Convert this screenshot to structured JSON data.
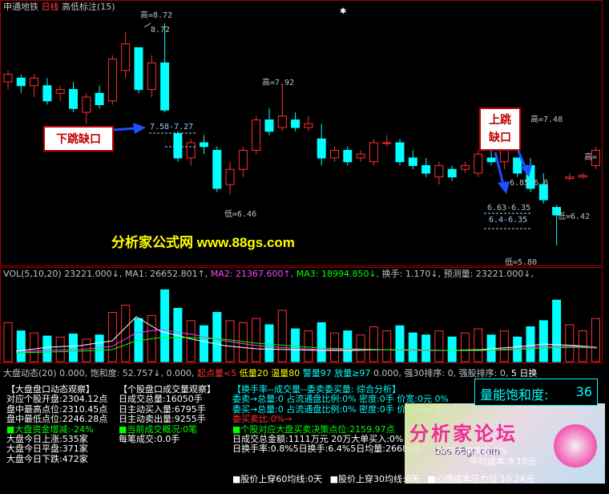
{
  "header": {
    "stock": "申通地铁",
    "period": "日线",
    "indicator": "高低标注(15)"
  },
  "main_chart": {
    "price_labels": {
      "high_1": "高=8.72",
      "high_1_sub": "8.72",
      "high_2": "高=7.92",
      "high_3": "高=7.48",
      "high_4": "高=",
      "low_1": "低=6.46",
      "low_2": "低=5.80",
      "low_3": "低=6.42",
      "gap_1": "7.58-7.27",
      "gap_2": "6.63-6.35",
      "gap_3": "6.4-6.35",
      "gap_4": "6.85-6.8"
    },
    "callout_down": "下跳缺口",
    "callout_up": "上跳\n缺口",
    "watermark": "分析家公式网 www.88gs.com"
  },
  "vol_header": {
    "name": "VOL(5,10,20)",
    "v": "23221.000↓,",
    "ma1": "MA1: 26652.801↑,",
    "ma2": "MA2: 21367.600↑,",
    "ma3": "MA3: 18994.850↓,",
    "turnover": "换手: 1.170↓,",
    "forecast": "预测量: 23221.000↓,"
  },
  "market_header": {
    "name": "大盘动态(20)",
    "v1": "0.000,",
    "saturation": "饱和度: 52.757↓,",
    "v2": "0.000,",
    "surge": "起点量<5",
    "low_vol": "低量20",
    "warm_vol": "温量80",
    "alert_vol": "警量97",
    "big_vol": "放量≥97",
    "v3": "0.000,",
    "strong30": "强30排序: 0,",
    "strong_stock": "强股排序: 0,",
    "day": "5 日换"
  },
  "panel1": {
    "title": "【大盘盘口动态观察】",
    "rows": [
      "对应个股开盘:2304.12点",
      "盘中最高点位:2310.45点",
      "盘中最低点位:2246.28点",
      "■大盘资金增减:-24%",
      "大盘今日上涨:535家",
      "大盘今日平盘:371家",
      "大盘今日下跌:472家"
    ]
  },
  "panel2": {
    "title": "【个股盘口成交量观察】",
    "rows": [
      "日成交总量:16050手",
      "日主动买入量:6795手",
      "日主动卖出量:9255手",
      "■当前成交概况:0笔",
      "每笔成交:0.0手"
    ]
  },
  "panel3": {
    "title": "【换手率--成交量--委卖委买量: 综合分析】",
    "rows": [
      "委卖→总量:0 占流通盘比例:0% 密度:0手 价宽:0元 0%",
      "委买→总量:0 占流通盘比例:0% 密度:0手 价宽:0元 0%",
      "委买卖比:0%→",
      "■个股对应大盘买卖决策点位:2159.97点",
      "日成交总金额:1111万元     20万大单买入:0%",
      "日换手率:0.8%5日换手:6.4%5日均量:26680手",
      "■股价上穿60均线:0天",
      "■股价上穿30均线:0天",
      "■心理成本压力位:10.24元"
    ],
    "row7_right": "20万大单卖出:0%",
    "row7_b": "平均成本:9.10元"
  },
  "sat_box": {
    "label": "量能饱和度:",
    "value": "36"
  },
  "forum_watermark": {
    "title": "分析家论坛",
    "url": "bbs.88gs.com"
  },
  "colors": {
    "up": "#ff3030",
    "down": "#00ffff",
    "text": "#c0c0c0",
    "yellow": "#ffff00",
    "green": "#00ff00"
  },
  "chart_data": {
    "type": "candlestick",
    "title": "申通地铁 日线",
    "candles": [
      {
        "o": 7.95,
        "h": 8.1,
        "l": 7.85,
        "c": 8.05
      },
      {
        "o": 8.0,
        "h": 8.05,
        "l": 7.8,
        "c": 7.9
      },
      {
        "o": 7.9,
        "h": 8.05,
        "l": 7.75,
        "c": 8.0
      },
      {
        "o": 7.9,
        "h": 8.0,
        "l": 7.65,
        "c": 7.7
      },
      {
        "o": 7.8,
        "h": 7.9,
        "l": 7.7,
        "c": 7.85
      },
      {
        "o": 7.85,
        "h": 7.95,
        "l": 7.55,
        "c": 7.6
      },
      {
        "o": 7.55,
        "h": 7.8,
        "l": 7.4,
        "c": 7.75
      },
      {
        "o": 7.8,
        "h": 7.9,
        "l": 7.6,
        "c": 7.65
      },
      {
        "o": 7.7,
        "h": 8.3,
        "l": 7.65,
        "c": 8.25
      },
      {
        "o": 8.1,
        "h": 8.6,
        "l": 8.0,
        "c": 8.45
      },
      {
        "o": 8.4,
        "h": 8.3,
        "l": 7.8,
        "c": 7.85
      },
      {
        "o": 7.85,
        "h": 8.3,
        "l": 7.75,
        "c": 8.2
      },
      {
        "o": 8.2,
        "h": 8.72,
        "l": 7.55,
        "c": 7.58
      },
      {
        "o": 7.27,
        "h": 7.3,
        "l": 6.9,
        "c": 6.95
      },
      {
        "o": 6.95,
        "h": 7.2,
        "l": 6.85,
        "c": 7.15
      },
      {
        "o": 7.15,
        "h": 7.25,
        "l": 7.0,
        "c": 7.1
      },
      {
        "o": 7.05,
        "h": 7.1,
        "l": 6.5,
        "c": 6.55
      },
      {
        "o": 6.6,
        "h": 6.9,
        "l": 6.46,
        "c": 6.8
      },
      {
        "o": 6.8,
        "h": 7.1,
        "l": 6.7,
        "c": 7.05
      },
      {
        "o": 7.05,
        "h": 7.5,
        "l": 7.0,
        "c": 7.45
      },
      {
        "o": 7.45,
        "h": 7.6,
        "l": 7.25,
        "c": 7.3
      },
      {
        "o": 7.35,
        "h": 7.92,
        "l": 7.3,
        "c": 7.5
      },
      {
        "o": 7.45,
        "h": 7.55,
        "l": 7.3,
        "c": 7.35
      },
      {
        "o": 7.35,
        "h": 7.5,
        "l": 7.3,
        "c": 7.4
      },
      {
        "o": 7.2,
        "h": 7.4,
        "l": 6.85,
        "c": 6.95
      },
      {
        "o": 6.95,
        "h": 7.1,
        "l": 6.9,
        "c": 7.05
      },
      {
        "o": 7.05,
        "h": 7.1,
        "l": 6.85,
        "c": 6.9
      },
      {
        "o": 6.95,
        "h": 7.05,
        "l": 6.9,
        "c": 7.0
      },
      {
        "o": 6.9,
        "h": 7.2,
        "l": 6.85,
        "c": 7.15
      },
      {
        "o": 7.15,
        "h": 7.25,
        "l": 7.1,
        "c": 7.15
      },
      {
        "o": 7.15,
        "h": 7.2,
        "l": 6.85,
        "c": 6.9
      },
      {
        "o": 6.95,
        "h": 7.05,
        "l": 6.8,
        "c": 6.85
      },
      {
        "o": 6.85,
        "h": 6.95,
        "l": 6.7,
        "c": 6.75
      },
      {
        "o": 6.7,
        "h": 6.9,
        "l": 6.6,
        "c": 6.85
      },
      {
        "o": 6.8,
        "h": 6.85,
        "l": 6.65,
        "c": 6.7
      },
      {
        "o": 6.8,
        "h": 6.9,
        "l": 6.75,
        "c": 6.85
      },
      {
        "o": 6.75,
        "h": 7.05,
        "l": 6.7,
        "c": 7.0
      },
      {
        "o": 6.95,
        "h": 7.1,
        "l": 6.85,
        "c": 6.9
      },
      {
        "o": 6.9,
        "h": 7.15,
        "l": 6.8,
        "c": 7.05
      },
      {
        "o": 6.95,
        "h": 6.95,
        "l": 6.7,
        "c": 6.75
      },
      {
        "o": 6.85,
        "h": 6.95,
        "l": 6.5,
        "c": 6.55
      },
      {
        "o": 6.6,
        "h": 6.75,
        "l": 6.35,
        "c": 6.4
      },
      {
        "o": 6.3,
        "h": 6.33,
        "l": 5.8,
        "c": 6.2
      },
      {
        "o": 6.68,
        "h": 6.75,
        "l": 6.65,
        "c": 6.7
      },
      {
        "o": 6.7,
        "h": 6.75,
        "l": 6.68,
        "c": 6.72
      },
      {
        "o": 6.85,
        "h": 7.1,
        "l": 6.8,
        "c": 7.05
      },
      {
        "o": 6.82,
        "h": 6.85,
        "l": 6.78,
        "c": 6.8
      },
      {
        "o": 6.75,
        "h": 6.8,
        "l": 6.42,
        "c": 6.45
      },
      {
        "o": 6.8,
        "h": 7.0,
        "l": 6.75,
        "c": 6.95
      },
      {
        "o": 6.88,
        "h": 6.92,
        "l": 6.85,
        "c": 6.9
      }
    ],
    "volume": [
      38,
      30,
      28,
      25,
      24,
      27,
      22,
      26,
      48,
      55,
      42,
      45,
      70,
      52,
      40,
      35,
      48,
      40,
      38,
      42,
      36,
      50,
      32,
      30,
      38,
      28,
      30,
      26,
      34,
      30,
      35,
      28,
      26,
      30,
      24,
      28,
      32,
      26,
      30,
      24,
      34,
      40,
      60,
      36,
      30,
      42,
      28,
      38,
      34,
      25
    ],
    "ylim": [
      5.6,
      8.9
    ]
  }
}
